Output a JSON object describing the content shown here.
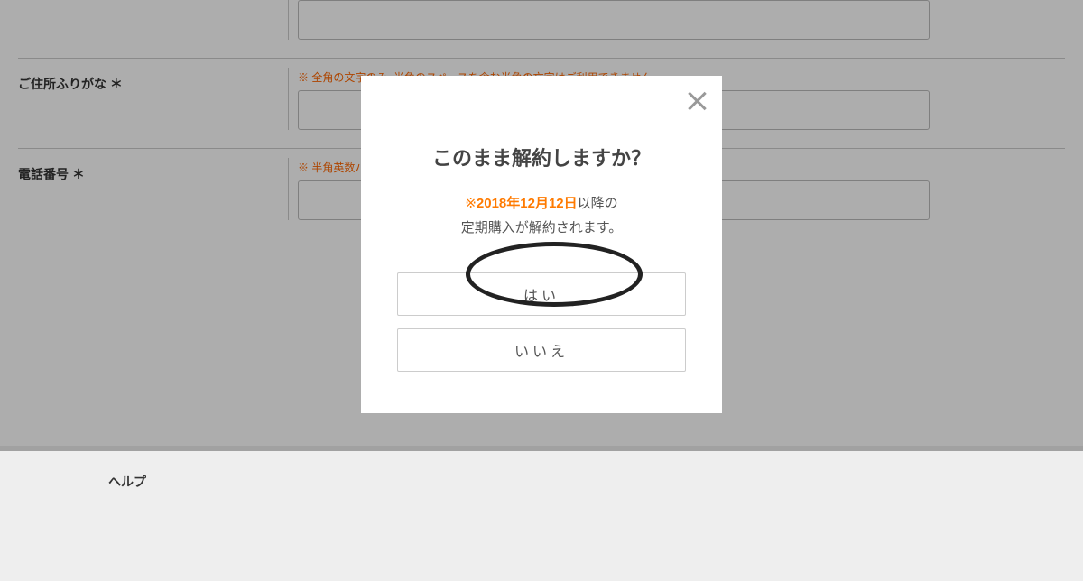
{
  "form": {
    "rows": [
      {
        "label": "",
        "hint": "",
        "value": ""
      },
      {
        "label": "ご住所ふりがな ＊",
        "hint": "※ 全角の文字のみ, 半角のスペースを含む半角の文字はご利用できません",
        "value": ""
      },
      {
        "label": "電話番号 ＊",
        "hint": "※ 半角英数ハイ",
        "value": ""
      }
    ]
  },
  "footer": {
    "help": "ヘルプ"
  },
  "modal": {
    "title": "このまま解約しますか？",
    "mark": "※",
    "date": "2018年12月12日",
    "after_text": "以降の",
    "line2": "定期購入が解約されます。",
    "yes": "はい",
    "no": "いいえ"
  }
}
